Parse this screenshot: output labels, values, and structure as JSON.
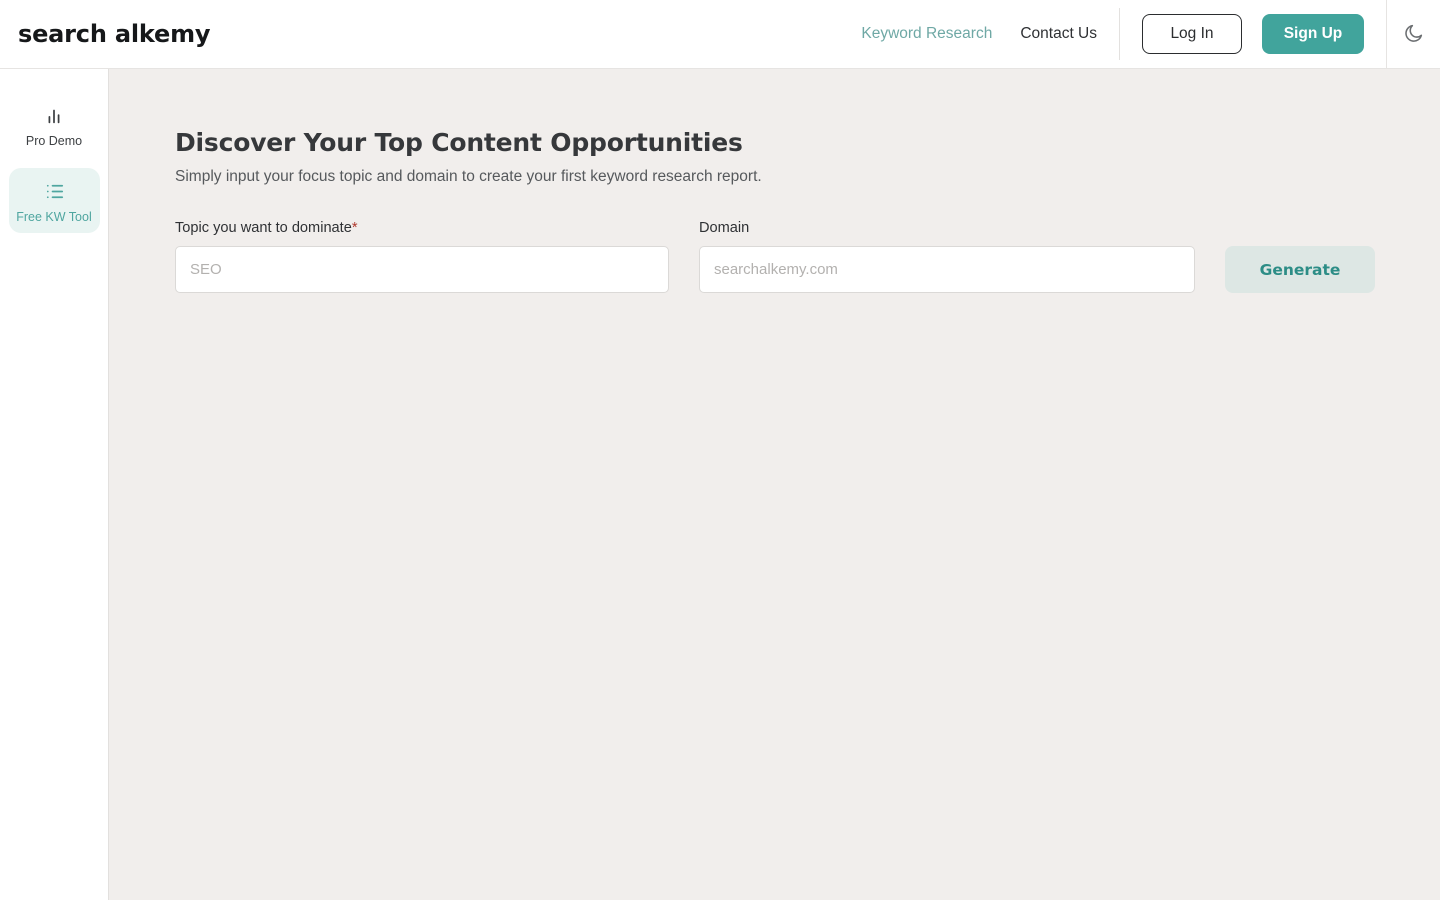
{
  "header": {
    "logo": "search alkemy",
    "nav": [
      {
        "label": "Keyword Research",
        "name": "nav-keyword-research",
        "accent": true
      },
      {
        "label": "Contact Us",
        "name": "nav-contact-us",
        "accent": false
      }
    ],
    "login_label": "Log In",
    "signup_label": "Sign Up",
    "theme_toggle_icon": "moon-icon"
  },
  "sidebar": {
    "items": [
      {
        "label": "Pro Demo",
        "icon": "bar-chart-icon",
        "active": false
      },
      {
        "label": "Free KW Tool",
        "icon": "list-icon",
        "active": true
      }
    ]
  },
  "main": {
    "title": "Discover Your Top Content Opportunities",
    "subtitle": "Simply input your focus topic and domain to create your first keyword research report.",
    "form": {
      "topic": {
        "label": "Topic you want to dominate",
        "required_marker": "*",
        "value": "",
        "placeholder": "SEO"
      },
      "domain": {
        "label": "Domain",
        "value": "",
        "placeholder": "searchalkemy.com"
      },
      "generate_label": "Generate"
    }
  },
  "colors": {
    "accent_teal": "#41a49c",
    "accent_teal_muted": "#6fa8a5",
    "generate_bg": "#dde7e4",
    "generate_text": "#2c8d86",
    "sidebar_active_bg": "#e9f4f2",
    "main_bg": "#f1eeec",
    "required_red": "#b03a2e"
  }
}
